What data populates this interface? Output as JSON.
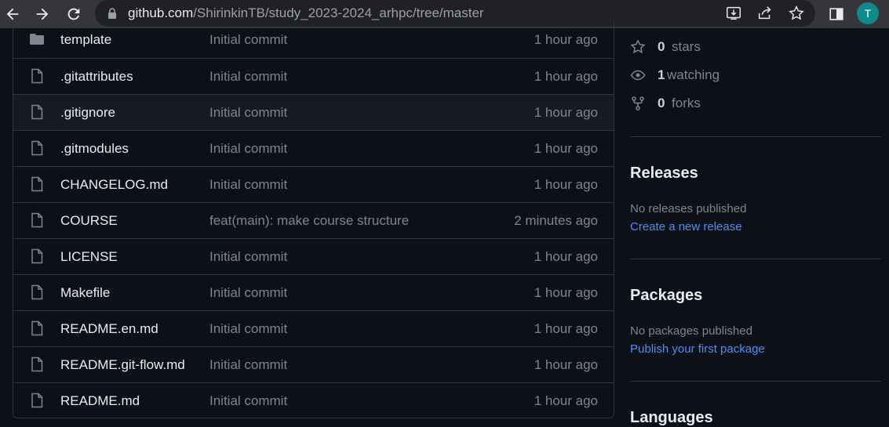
{
  "browser": {
    "url_host": "github.com",
    "url_path": "/ShirinkinTB/study_2023-2024_arhpc/tree/master",
    "avatar_letter": "T",
    "icons": [
      "back-icon",
      "forward-icon",
      "reload-icon",
      "lock-icon",
      "install-app-icon",
      "share-icon",
      "bookmark-star-icon",
      "side-panel-icon"
    ]
  },
  "files": [
    {
      "type": "folder",
      "name": "template",
      "message": "Initial commit",
      "time": "1 hour ago"
    },
    {
      "type": "file",
      "name": ".gitattributes",
      "message": "Initial commit",
      "time": "1 hour ago"
    },
    {
      "type": "file",
      "name": ".gitignore",
      "message": "Initial commit",
      "time": "1 hour ago"
    },
    {
      "type": "file",
      "name": ".gitmodules",
      "message": "Initial commit",
      "time": "1 hour ago"
    },
    {
      "type": "file",
      "name": "CHANGELOG.md",
      "message": "Initial commit",
      "time": "1 hour ago"
    },
    {
      "type": "file",
      "name": "COURSE",
      "message": "feat(main): make course structure",
      "time": "2 minutes ago"
    },
    {
      "type": "file",
      "name": "LICENSE",
      "message": "Initial commit",
      "time": "1 hour ago"
    },
    {
      "type": "file",
      "name": "Makefile",
      "message": "Initial commit",
      "time": "1 hour ago"
    },
    {
      "type": "file",
      "name": "README.en.md",
      "message": "Initial commit",
      "time": "1 hour ago"
    },
    {
      "type": "file",
      "name": "README.git-flow.md",
      "message": "Initial commit",
      "time": "1 hour ago"
    },
    {
      "type": "file",
      "name": "README.md",
      "message": "Initial commit",
      "time": "1 hour ago"
    }
  ],
  "sidebar": {
    "stars": {
      "count": "0",
      "label": "stars"
    },
    "watching": {
      "count": "1",
      "label": "watching"
    },
    "forks": {
      "count": "0",
      "label": "forks"
    },
    "releases": {
      "heading": "Releases",
      "empty_text": "No releases published",
      "link": "Create a new release"
    },
    "packages": {
      "heading": "Packages",
      "empty_text": "No packages published",
      "link": "Publish your first package"
    },
    "languages": {
      "heading": "Languages"
    }
  },
  "colors": {
    "page_bg": "#0d1117",
    "border": "#30363d",
    "muted_text": "#7d8590",
    "link": "#4493f8",
    "avatar": "#0e8a8a"
  }
}
